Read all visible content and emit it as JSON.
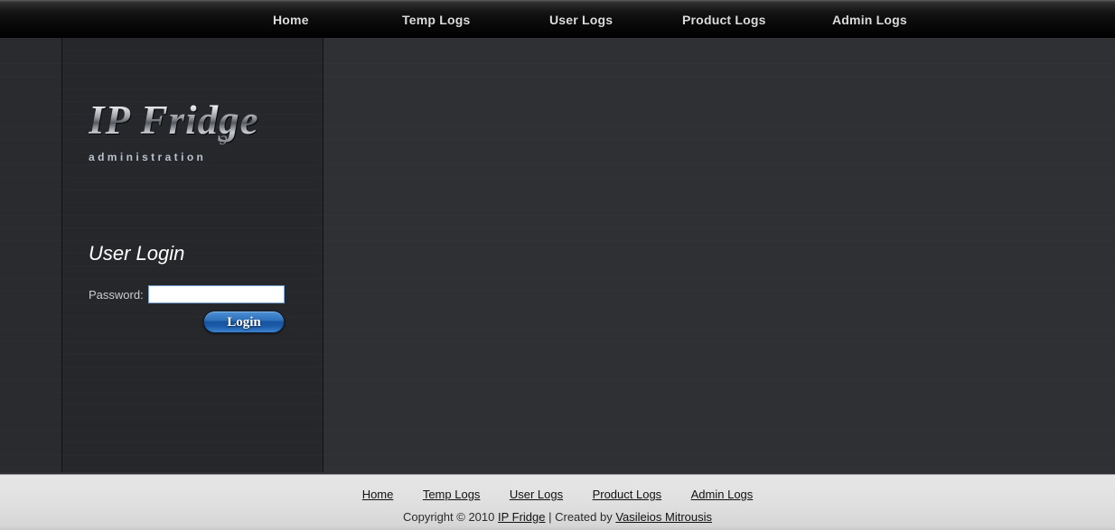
{
  "topnav": {
    "items": [
      {
        "label": "Home",
        "name": "nav-home"
      },
      {
        "label": "Temp Logs",
        "name": "nav-temp-logs"
      },
      {
        "label": "User Logs",
        "name": "nav-user-logs"
      },
      {
        "label": "Product Logs",
        "name": "nav-product-logs"
      },
      {
        "label": "Admin Logs",
        "name": "nav-admin-logs"
      }
    ]
  },
  "sidebar": {
    "logo": {
      "wordmark": "IP Fridge",
      "swirl_glyph": "ɔ",
      "subtitle": "administration"
    },
    "login": {
      "title": "User Login",
      "password_label": "Password:",
      "password_value": "",
      "password_placeholder": "",
      "submit_label": "Login"
    }
  },
  "footer": {
    "links": [
      {
        "label": "Home"
      },
      {
        "label": "Temp Logs"
      },
      {
        "label": "User Logs"
      },
      {
        "label": "Product Logs"
      },
      {
        "label": "Admin Logs"
      }
    ],
    "copyright_prefix": "Copyright © 2010 ",
    "site_link": "IP Fridge",
    "separator": " | Created by ",
    "author_link": "Vasileios Mitrousis"
  },
  "colors": {
    "page_background": "#2f3034",
    "sidebar_background": "#26272b",
    "nav_text": "#dcdcdc",
    "accent_blue": "#2f72bd",
    "footer_background": "#e1e1e1"
  }
}
